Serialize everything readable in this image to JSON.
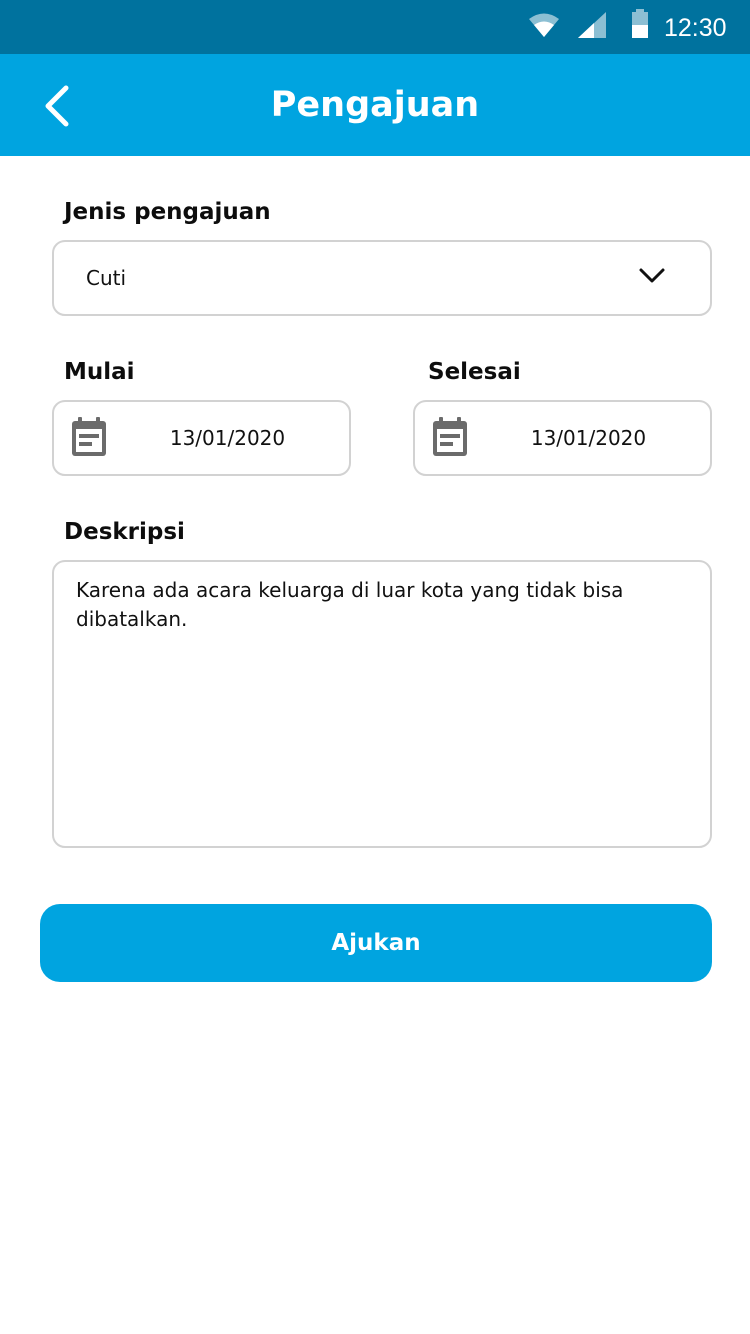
{
  "status_bar": {
    "time": "12:30",
    "icons": [
      "wifi-icon",
      "signal-icon",
      "battery-icon"
    ]
  },
  "app_bar": {
    "title": "Pengajuan",
    "back_icon": "chevron-left-icon"
  },
  "form": {
    "type": {
      "label": "Jenis pengajuan",
      "value": "Cuti"
    },
    "start": {
      "label": "Mulai",
      "value": "13/01/2020"
    },
    "end": {
      "label": "Selesai",
      "value": "13/01/2020"
    },
    "description": {
      "label": "Deskripsi",
      "value": "Karena ada acara keluarga di luar kota yang tidak bisa dibatalkan."
    },
    "submit_label": "Ajukan"
  },
  "colors": {
    "status_bar": "#00729e",
    "primary": "#00a4e0",
    "border": "#d2d2d2",
    "icon_gray": "#6b6b6b"
  }
}
